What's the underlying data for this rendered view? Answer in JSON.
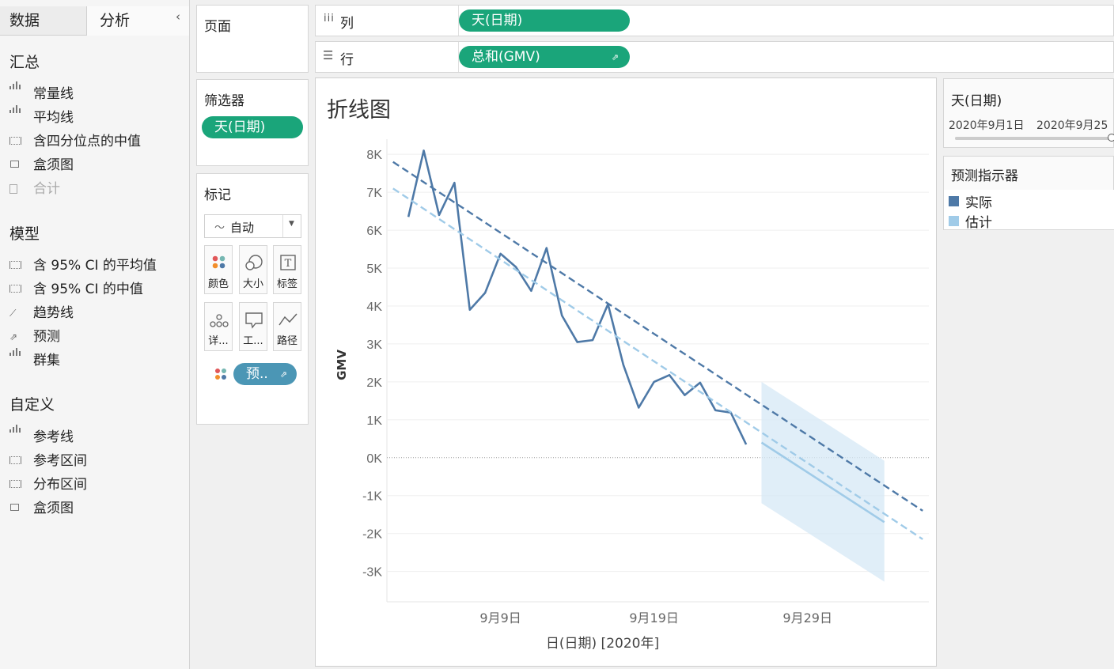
{
  "left_pane": {
    "tabs": [
      "数据",
      "分析"
    ],
    "sections": [
      {
        "title": "汇总",
        "items": [
          {
            "label": "常量线",
            "icon": "reference-line-icon",
            "enabled": true
          },
          {
            "label": "平均线",
            "icon": "reference-line-icon",
            "enabled": true
          },
          {
            "label": "含四分位点的中值",
            "icon": "band-icon",
            "enabled": true
          },
          {
            "label": "盒须图",
            "icon": "boxplot-icon",
            "enabled": true
          },
          {
            "label": "合计",
            "icon": "total-icon",
            "enabled": false
          }
        ]
      },
      {
        "title": "模型",
        "items": [
          {
            "label": "含 95% CI 的平均值",
            "icon": "band-icon",
            "enabled": true
          },
          {
            "label": "含 95% CI 的中值",
            "icon": "band-icon",
            "enabled": true
          },
          {
            "label": "趋势线",
            "icon": "trend-icon",
            "enabled": true
          },
          {
            "label": "预测",
            "icon": "forecast-icon",
            "enabled": true
          },
          {
            "label": "群集",
            "icon": "cluster-icon",
            "enabled": true
          }
        ]
      },
      {
        "title": "自定义",
        "items": [
          {
            "label": "参考线",
            "icon": "reference-line-icon",
            "enabled": true
          },
          {
            "label": "参考区间",
            "icon": "band-icon",
            "enabled": true
          },
          {
            "label": "分布区间",
            "icon": "band-icon",
            "enabled": true
          },
          {
            "label": "盒须图",
            "icon": "boxplot-icon",
            "enabled": true
          }
        ]
      }
    ]
  },
  "shelves": {
    "pages_label": "页面",
    "filters_label": "筛选器",
    "filter_pill": "天(日期)",
    "columns_label": "列",
    "columns_pill": "天(日期)",
    "rows_label": "行",
    "rows_pill": "总和(GMV)"
  },
  "marks": {
    "title": "标记",
    "mark_type": "自动",
    "buttons": [
      "颜色",
      "大小",
      "标签",
      "详...",
      "工...",
      "路径"
    ],
    "color_pill": "预.."
  },
  "viz": {
    "title": "折线图"
  },
  "legends": {
    "date_filter": {
      "title": "天(日期)",
      "range_start": "2020年9月1日",
      "range_end": "2020年9月25",
      "fraction": 0.98
    },
    "forecast": {
      "title": "预测指示器",
      "items": [
        {
          "label": "实际",
          "color": "#4e79a7"
        },
        {
          "label": "估计",
          "color": "#a0cbe8"
        }
      ]
    }
  },
  "colors": {
    "pill_green": "#1aa57a",
    "pill_blue": "#4b96b5",
    "actual": "#4e79a7",
    "estimate": "#a0cbe8"
  },
  "chart_data": {
    "type": "line",
    "title": "折线图",
    "xlabel": "日(日期) [2020年]",
    "ylabel": "GMV",
    "x_tick_labels": [
      "9月9日",
      "9月19日",
      "9月29日"
    ],
    "x_tick_days": [
      9,
      19,
      29
    ],
    "xlim": [
      1.6,
      36.9
    ],
    "y_tick_values": [
      8000,
      7000,
      6000,
      5000,
      4000,
      3000,
      2000,
      1000,
      0,
      -1000,
      -2000,
      -3000
    ],
    "y_tick_labels": [
      "8K",
      "7K",
      "6K",
      "5K",
      "4K",
      "3K",
      "2K",
      "1K",
      "0K",
      "-1K",
      "-2K",
      "-3K"
    ],
    "ylim": [
      -3800,
      8400
    ],
    "series": [
      {
        "name": "实际",
        "style": "solid",
        "x": [
          3,
          4,
          5,
          6,
          7,
          8,
          9,
          10,
          11,
          12,
          13,
          14,
          15,
          16,
          17,
          18,
          19,
          20,
          21,
          22,
          23,
          24,
          25
        ],
        "y": [
          6350,
          8100,
          6400,
          7250,
          3900,
          4350,
          5380,
          5030,
          4400,
          5530,
          3750,
          3050,
          3100,
          4050,
          2450,
          1320,
          2000,
          2180,
          1650,
          1980,
          1250,
          1190,
          350
        ]
      },
      {
        "name": "实际 趋势",
        "style": "dashed",
        "x": [
          2,
          36.5
        ],
        "y": [
          7800,
          -1400
        ]
      },
      {
        "name": "估计 趋势",
        "style": "dashed",
        "x": [
          2,
          36.5
        ],
        "y": [
          7100,
          -2150
        ]
      },
      {
        "name": "估计",
        "style": "solid",
        "x": [
          26,
          34
        ],
        "y": [
          400,
          -1700
        ]
      }
    ],
    "forecast_band": {
      "x": [
        26,
        34
      ],
      "upper": [
        2000,
        -80
      ],
      "lower": [
        -1200,
        -3270
      ]
    },
    "grid": true
  }
}
